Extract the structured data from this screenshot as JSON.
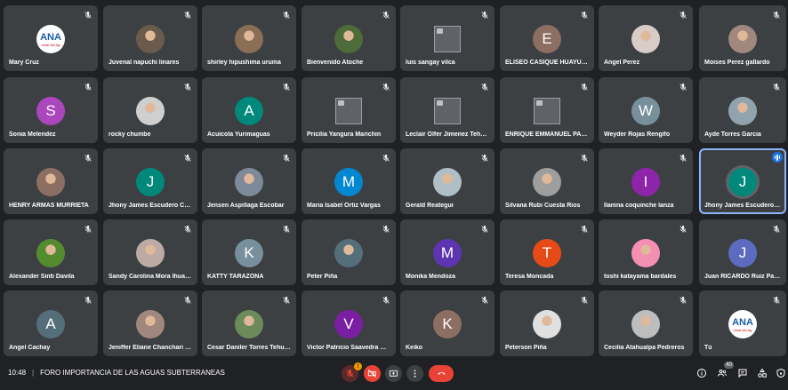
{
  "colors": {
    "background": "#202124",
    "tile": "#3c4043",
    "hangup": "#ea4335",
    "speaking_outline": "#8ab4f8"
  },
  "participants": [
    {
      "name": "Mary Cruz",
      "avatar": "logo",
      "logo_text": "ANA",
      "logo_sub": "ional del Ag"
    },
    {
      "name": "Juvenal napuchi linares",
      "avatar": "photo",
      "color": "#6b5b4a"
    },
    {
      "name": "shirley hipushima uruma",
      "avatar": "photo",
      "color": "#8a6f55"
    },
    {
      "name": "Bienvenido Atoche",
      "avatar": "photo",
      "color": "#4e6b3a"
    },
    {
      "name": "luis sangay vilca",
      "avatar": "broken"
    },
    {
      "name": "ELISEO CASIQUE HUAYUNGA",
      "avatar": "letter",
      "letter": "E",
      "color": "#8d6e63"
    },
    {
      "name": "Angel Perez",
      "avatar": "photo",
      "color": "#d7ccc8"
    },
    {
      "name": "Moises Perez gallardo",
      "avatar": "photo",
      "color": "#a1887f"
    },
    {
      "name": "Sonia Melendez",
      "avatar": "letter",
      "letter": "S",
      "color": "#ab47bc"
    },
    {
      "name": "rocky chumbe",
      "avatar": "photo",
      "color": "#cfcfcf"
    },
    {
      "name": "Acuicola Yurimaguas",
      "avatar": "letter",
      "letter": "A",
      "color": "#00897b"
    },
    {
      "name": "Pricilia Yangura Marichin",
      "avatar": "broken"
    },
    {
      "name": "Leclair Olfer Jimenez Tehuay",
      "avatar": "broken"
    },
    {
      "name": "ENRIQUE EMMANUEL PALA...",
      "avatar": "broken"
    },
    {
      "name": "Weyder Rojas Rengifo",
      "avatar": "letter",
      "letter": "W",
      "color": "#78909c"
    },
    {
      "name": "Ayde Torres Garcia",
      "avatar": "photo",
      "color": "#90a4ae"
    },
    {
      "name": "HENRY ARMAS MURRIETA",
      "avatar": "photo",
      "color": "#8d6e63"
    },
    {
      "name": "Jhony James Escudero Cont...",
      "avatar": "letter",
      "letter": "J",
      "color": "#00897b"
    },
    {
      "name": "Jensen Aspillaga Escobar",
      "avatar": "photo",
      "color": "#7d8a99"
    },
    {
      "name": "Maria Isabel Ortiz Vargas",
      "avatar": "letter",
      "letter": "M",
      "color": "#0288d1"
    },
    {
      "name": "Gerald Reategui",
      "avatar": "photo",
      "color": "#b0bec5"
    },
    {
      "name": "Silvana Rubi Cuesta Rios",
      "avatar": "photo",
      "color": "#9e9e9e"
    },
    {
      "name": "Ilanina coquinche lanza",
      "avatar": "letter",
      "letter": "I",
      "color": "#8e24aa"
    },
    {
      "name": "Jhony James Escudero Cont...",
      "avatar": "letter",
      "letter": "J",
      "color": "#00897b",
      "speaking": true
    },
    {
      "name": "Alexander Sinti Davila",
      "avatar": "photo",
      "color": "#558b2f"
    },
    {
      "name": "Sandy Carolina Mora Ihuara...",
      "avatar": "photo",
      "color": "#bcaaa4"
    },
    {
      "name": "KATTY TARAZONA",
      "avatar": "letter",
      "letter": "K",
      "color": "#78909c"
    },
    {
      "name": "Peter Piña",
      "avatar": "photo",
      "color": "#546e7a"
    },
    {
      "name": "Monika Mendoza",
      "avatar": "letter",
      "letter": "M",
      "color": "#5e35b1"
    },
    {
      "name": "Teresa Moncada",
      "avatar": "letter",
      "letter": "T",
      "color": "#e64a19"
    },
    {
      "name": "toshi katayama bardales",
      "avatar": "photo",
      "color": "#f48fb1"
    },
    {
      "name": "Juan RICARDO Ruiz Panduro",
      "avatar": "letter",
      "letter": "J",
      "color": "#5c6bc0"
    },
    {
      "name": "Angel Cachay",
      "avatar": "letter",
      "letter": "A",
      "color": "#546e7a"
    },
    {
      "name": "Jeniffer Eliane Chanchari Na...",
      "avatar": "photo",
      "color": "#a1887f"
    },
    {
      "name": "Cesar Daniler Torres Tehuay",
      "avatar": "photo",
      "color": "#6d8b5a"
    },
    {
      "name": "Victor Patricio Saavedra Cha...",
      "avatar": "letter",
      "letter": "V",
      "color": "#7b1fa2"
    },
    {
      "name": "Keiko",
      "avatar": "letter",
      "letter": "K",
      "color": "#8d6e63"
    },
    {
      "name": "Peterson Piña",
      "avatar": "photo",
      "color": "#e0e0e0"
    },
    {
      "name": "Cecilia Atahualpa Pedreros",
      "avatar": "photo",
      "color": "#bdbdbd"
    },
    {
      "name": "Tú",
      "avatar": "logo",
      "logo_text": "ANA",
      "logo_sub": "ional del Ag"
    }
  ],
  "bottombar": {
    "time": "10:48",
    "separator": "|",
    "meeting_title": "FORO IMPORTANCIA DE LAS AGUAS SUBTERRANEAS",
    "mic_badge": "!",
    "participants_count": "40"
  }
}
